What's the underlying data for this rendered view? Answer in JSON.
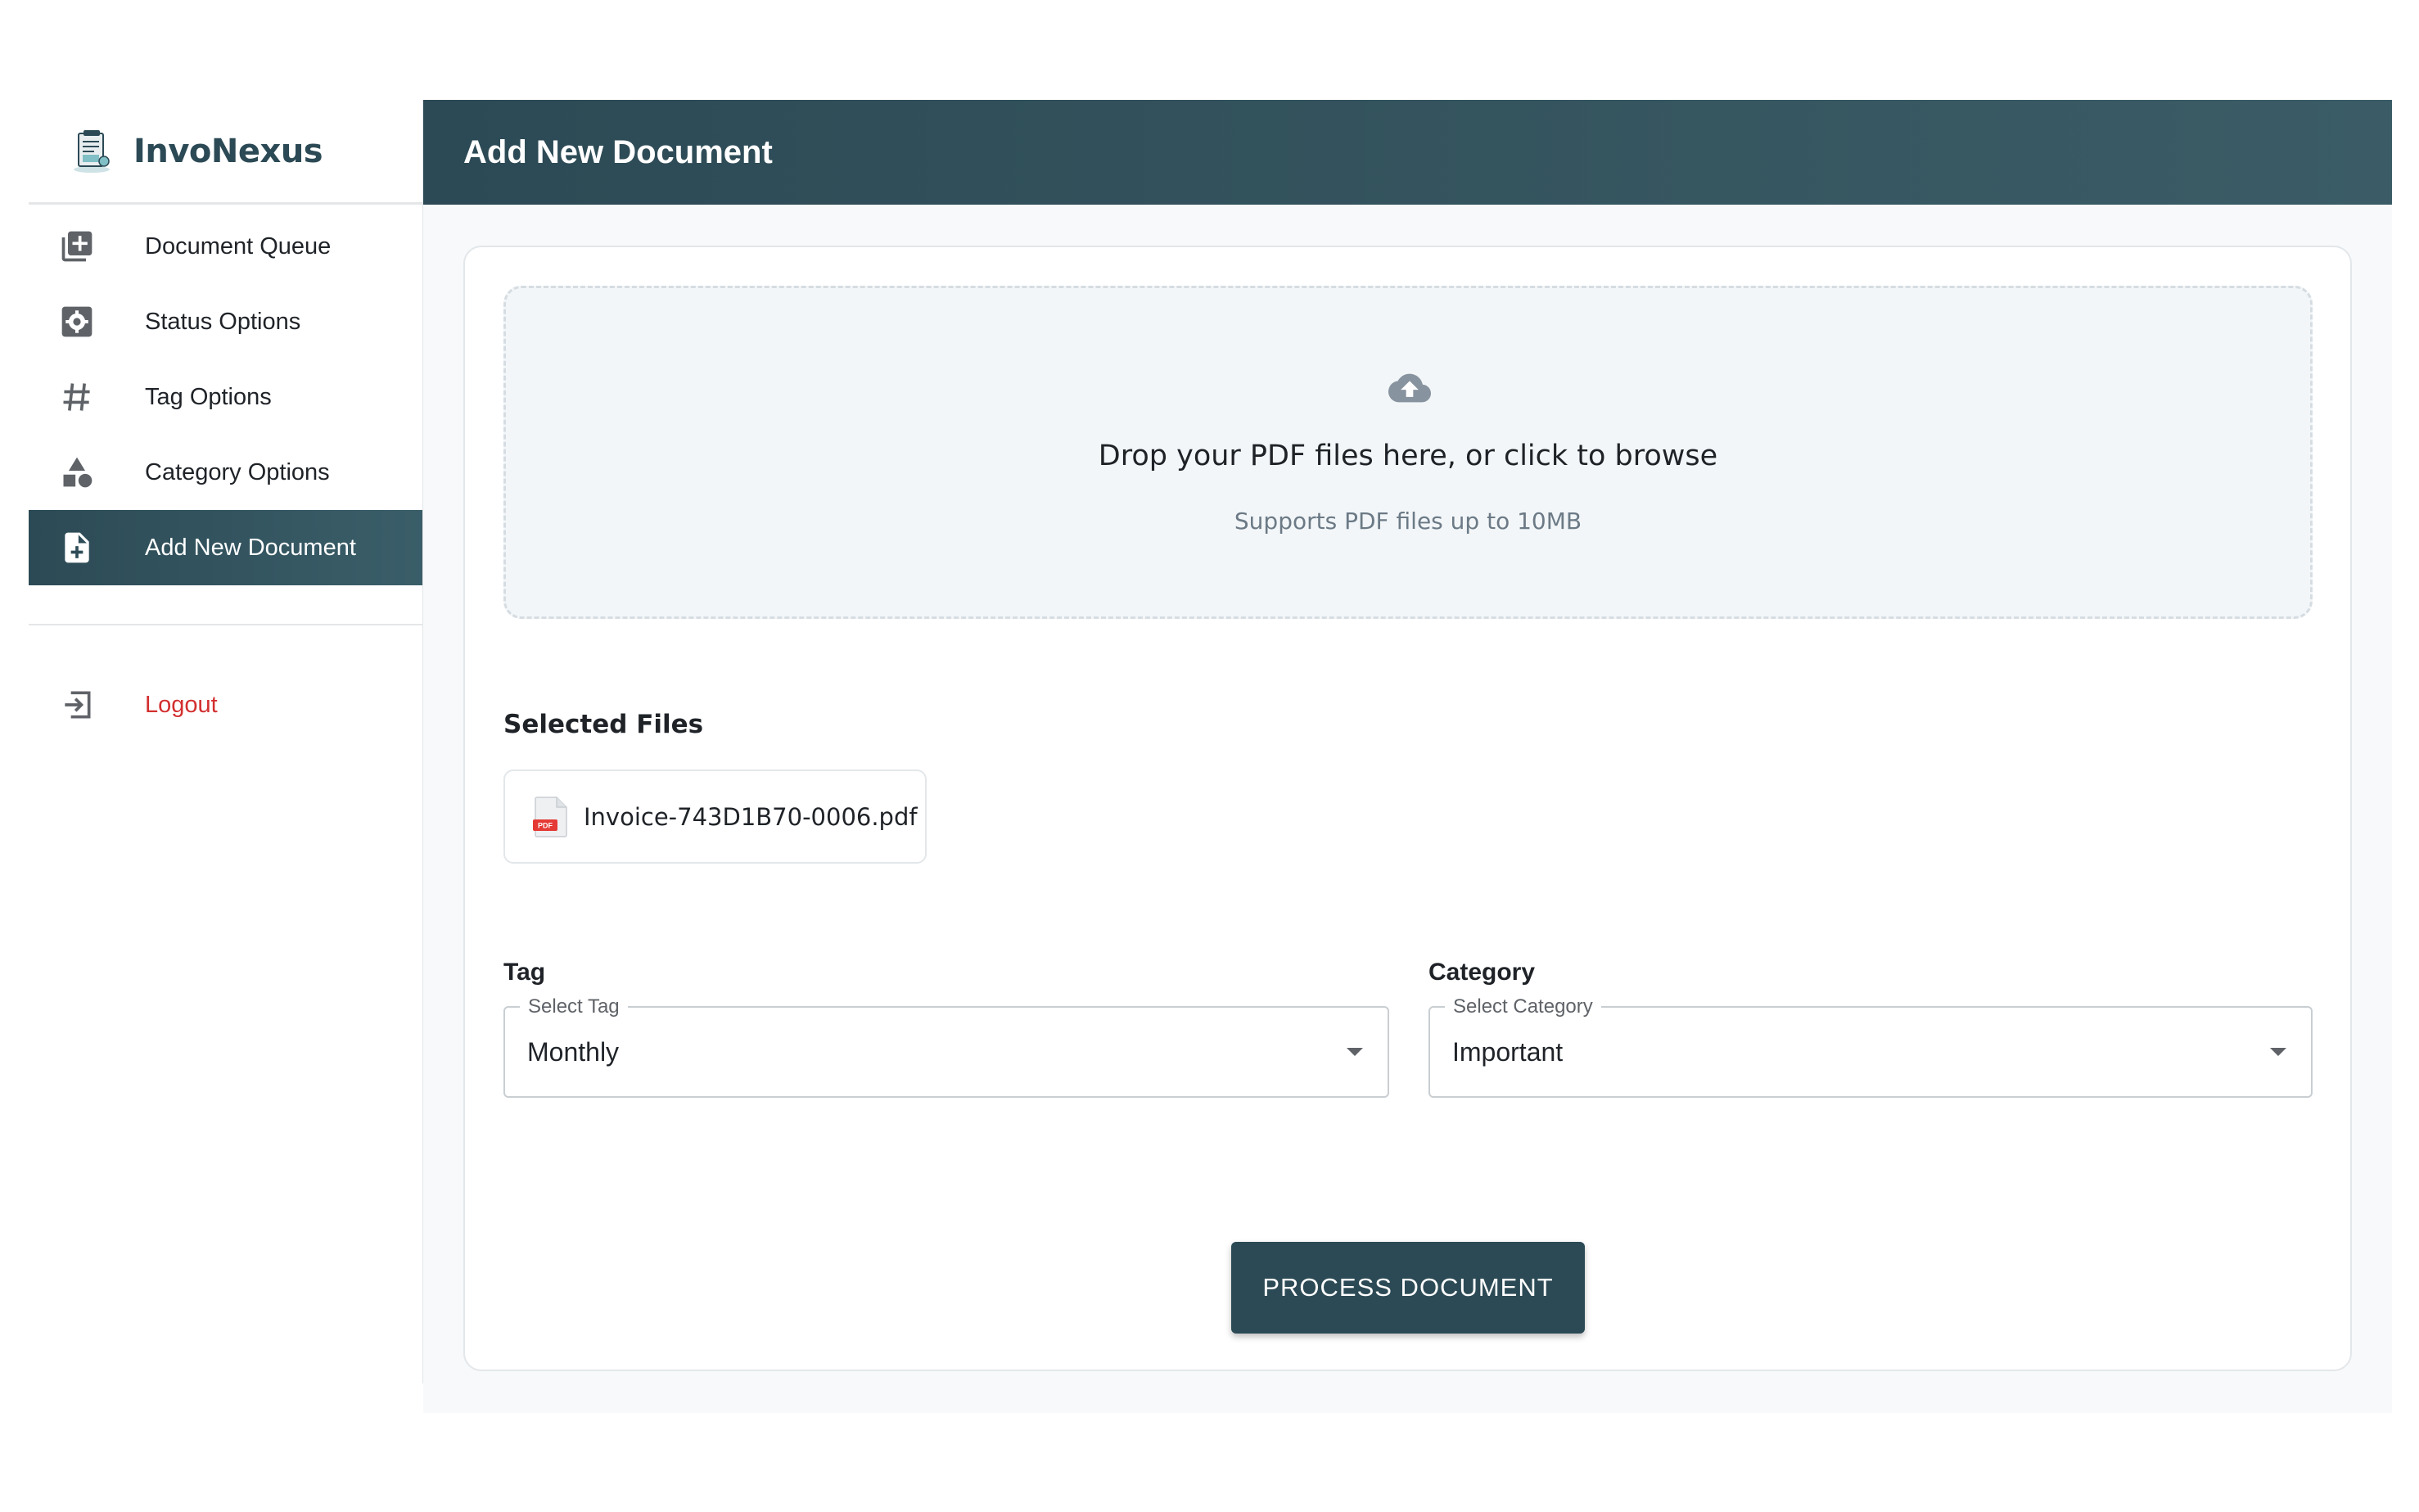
{
  "app": {
    "name": "InvoNexus"
  },
  "sidebar": {
    "items": [
      {
        "label": "Document Queue",
        "icon": "library-add-icon"
      },
      {
        "label": "Status Options",
        "icon": "settings-box-icon"
      },
      {
        "label": "Tag Options",
        "icon": "hashtag-icon"
      },
      {
        "label": "Category Options",
        "icon": "shapes-icon"
      },
      {
        "label": "Add New Document",
        "icon": "file-add-icon",
        "active": true
      }
    ],
    "logout_label": "Logout"
  },
  "header": {
    "title": "Add New Document"
  },
  "upload": {
    "title": "Drop your PDF files here, or click to browse",
    "subtitle": "Supports PDF files up to 10MB"
  },
  "selected_files": {
    "title": "Selected Files",
    "files": [
      {
        "name": "Invoice-743D1B70-0006.pdf"
      }
    ]
  },
  "tag": {
    "label": "Tag",
    "legend": "Select Tag",
    "value": "Monthly"
  },
  "category": {
    "label": "Category",
    "legend": "Select Category",
    "value": "Important"
  },
  "actions": {
    "process_label": "PROCESS DOCUMENT"
  },
  "colors": {
    "primary": "#2c4a55",
    "logout": "#d32f2f",
    "dropzone_bg": "#f3f6f8"
  }
}
